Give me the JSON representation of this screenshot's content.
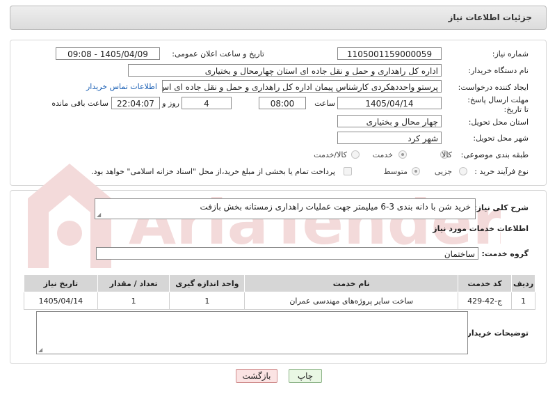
{
  "header": {
    "title": "جزئیات اطلاعات نیاز"
  },
  "form": {
    "need_number_label": "شماره نیاز:",
    "need_number": "1105001159000059",
    "announce_label": "تاریخ و ساعت اعلان عمومی:",
    "announce_value": "1405/04/09 - 09:08",
    "buyer_org_label": "نام دستگاه خریدار:",
    "buyer_org": "اداره کل راهداری و حمل و نقل جاده ای استان چهارمحال و بختیاری",
    "creator_label": "ایجاد کننده درخواست:",
    "creator": "پرستو واحددهکردی کارشناس پیمان اداره کل راهداری و حمل و نقل جاده ای اس",
    "contact_link": "اطلاعات تماس خریدار",
    "deadline_label": "مهلت ارسال پاسخ: تا تاریخ:",
    "deadline_date": "1405/04/14",
    "time_label": "ساعت",
    "deadline_time": "08:00",
    "days_value": "4",
    "days_label": "روز و",
    "remaining_time": "22:04:07",
    "remaining_label": "ساعت باقی مانده",
    "province_label": "استان محل تحویل:",
    "province": "چهار محال و بختیاری",
    "city_label": "شهر محل تحویل:",
    "city": "شهر کرد",
    "category_label": "طبقه بندی موضوعی:",
    "category_options": [
      "کالا",
      "خدمت",
      "کالا/خدمت"
    ],
    "process_label": "نوع فرآیند خرید :",
    "process_options": [
      "جزیی",
      "متوسط"
    ],
    "payment_note": "پرداخت تمام یا بخشی از مبلغ خرید،از محل \"اسناد خزانه اسلامی\" خواهد بود."
  },
  "summary": {
    "label": "شرح کلی نیاز:",
    "text": "خرید شن با دانه بندی 3-6 میلیمتر جهت عملیات راهداری زمستانه بخش بازفت"
  },
  "services": {
    "section_title": "اطلاعات خدمات مورد نیاز",
    "group_label": "گروه خدمت:",
    "group_value": "ساختمان",
    "columns": [
      "ردیف",
      "کد خدمت",
      "نام خدمت",
      "واحد اندازه گیری",
      "تعداد / مقدار",
      "تاریخ نیاز"
    ],
    "rows": [
      [
        "1",
        "ج-42-429",
        "ساخت سایر پروژه‌های مهندسی عمران",
        "1",
        "1",
        "1405/04/14"
      ]
    ]
  },
  "notes": {
    "label": "توضیحات خریدار:",
    "value": ""
  },
  "buttons": {
    "print": "چاپ",
    "back": "بازگشت"
  },
  "watermark": {
    "text": "AriaTender.net"
  },
  "colors": {
    "header_bg": "#dcdcdc",
    "table_header_bg": "#d6d6d6",
    "link": "#1a5fb4",
    "print_button_bg": "#e9f7e4",
    "back_button_bg": "#fbe3e3",
    "watermark": "#f1d6d6"
  }
}
